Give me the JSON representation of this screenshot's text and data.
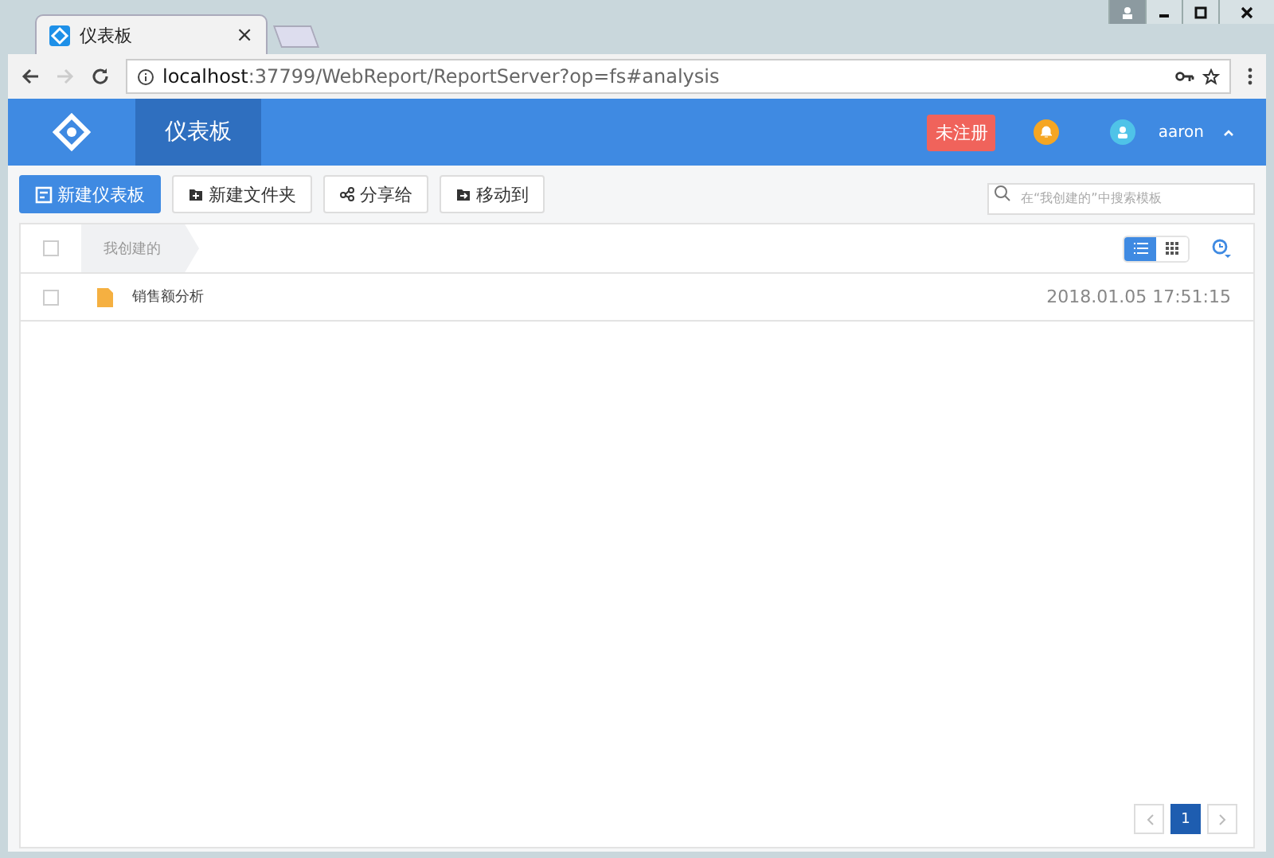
{
  "browser": {
    "tab_title": "仪表板",
    "tab_close": "×",
    "url_host": "localhost",
    "url_rest": ":37799/WebReport/ReportServer?op=fs#analysis"
  },
  "header": {
    "nav": [
      {
        "label": "仪表板",
        "selected": true
      }
    ],
    "badge": "未注册",
    "user": "aaron"
  },
  "toolbar": {
    "buttons": [
      {
        "label": "新建仪表板",
        "kind": "primary"
      },
      {
        "label": "新建文件夹",
        "kind": "folder"
      },
      {
        "label": "分享给",
        "kind": "share"
      },
      {
        "label": "移动到",
        "kind": "move"
      }
    ],
    "search": {
      "placeholder": "在“我创建的”中搜索模板"
    }
  },
  "list": {
    "breadcrumb": "我创建的",
    "select_all": {
      "checked": false
    },
    "views": [
      {
        "kind": "list",
        "selected": true
      },
      {
        "kind": "grid",
        "selected": false
      }
    ],
    "rows": [
      {
        "name": "销售额分析",
        "time": "2018.01.05 17:51:15",
        "checked": false
      }
    ]
  },
  "pagination": {
    "pages": [
      {
        "label": "1",
        "selected": true
      }
    ]
  }
}
